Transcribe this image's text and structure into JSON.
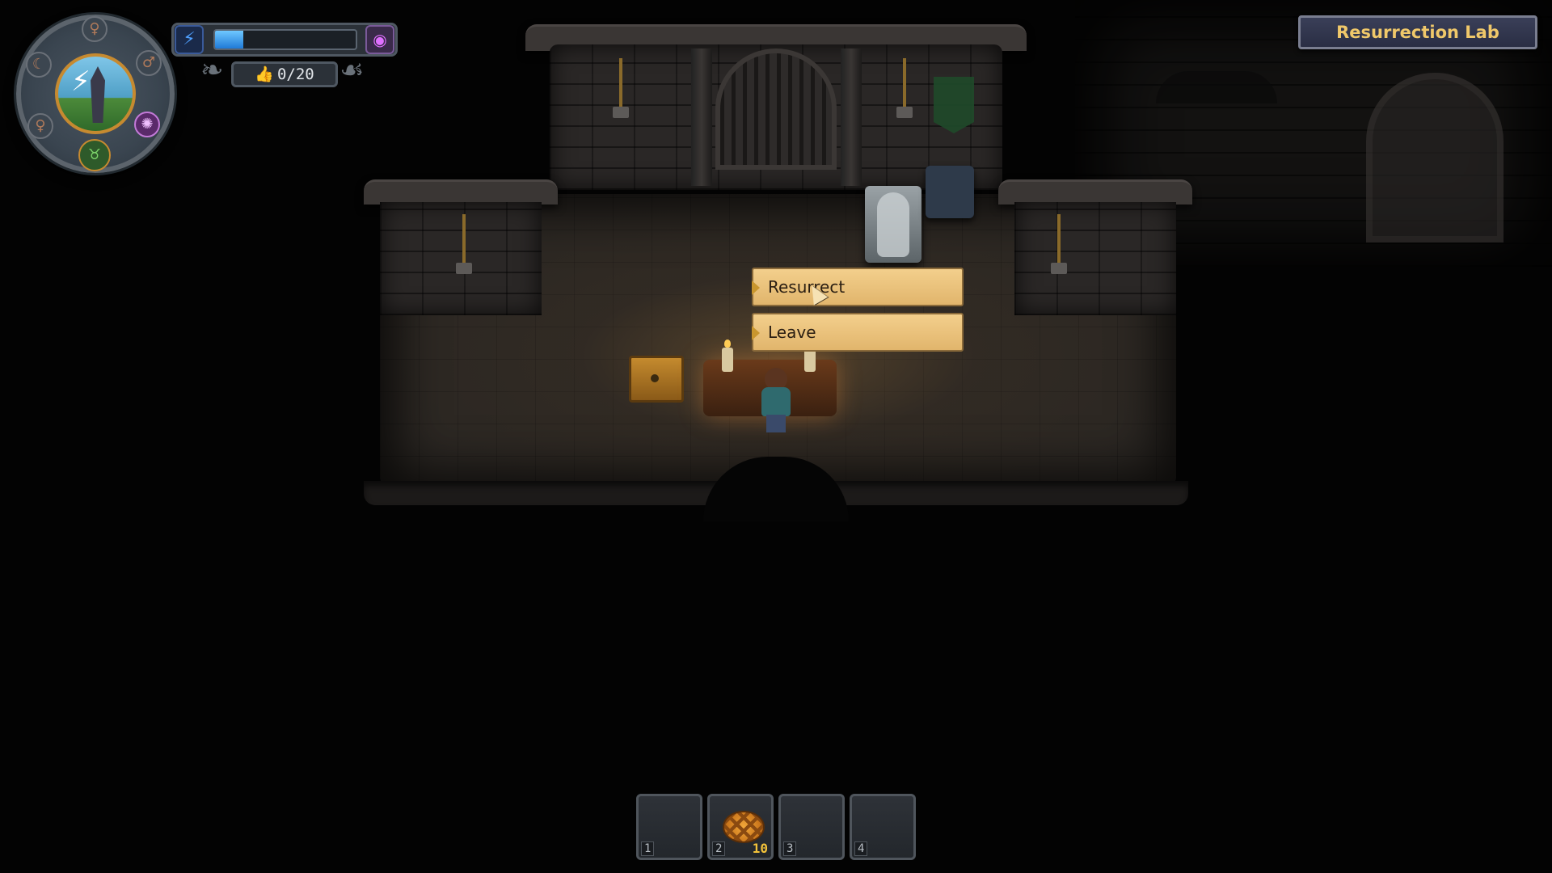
{
  "location": {
    "title": "Resurrection Lab"
  },
  "hud": {
    "energy_fraction": 0.2,
    "energy_icon": "lightning-icon",
    "faith_icon": "faith-swirl-icon",
    "technology_points": "0/20",
    "technology_icon": "thumbs-up-icon",
    "medallion_slots": [
      "top-slot",
      "left-slot",
      "right-slot",
      "right-lower-slot-purple",
      "bottom-slot-green"
    ]
  },
  "dialog": {
    "options": [
      {
        "label": "Resurrect"
      },
      {
        "label": "Leave"
      }
    ]
  },
  "hotbar": {
    "slots": [
      {
        "number": "1",
        "item": "",
        "count": ""
      },
      {
        "number": "2",
        "item": "pie-icon",
        "count": "10"
      },
      {
        "number": "3",
        "item": "",
        "count": ""
      },
      {
        "number": "4",
        "item": "",
        "count": ""
      }
    ]
  },
  "colors": {
    "location_text": "#f0c86a",
    "dialog_bg": "#f3cf8c",
    "energy_fill": "#1f7ad8"
  }
}
